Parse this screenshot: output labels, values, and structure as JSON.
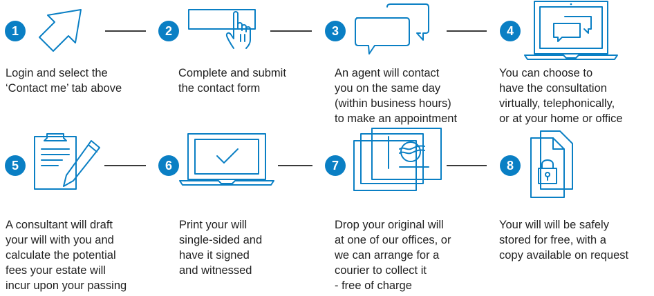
{
  "steps": [
    {
      "number": "1",
      "icon": "arrow-cursor-icon",
      "text": "Login and select the\n‘Contact me’ tab above"
    },
    {
      "number": "2",
      "icon": "hand-click-button-icon",
      "text": "Complete and submit\nthe contact form"
    },
    {
      "number": "3",
      "icon": "chat-bubbles-icon",
      "text": "An agent will contact\nyou on the same day\n(within business hours)\nto make an appointment"
    },
    {
      "number": "4",
      "icon": "laptop-chat-icon",
      "text": "You can choose to\nhave the consultation\nvirtually, telephonically,\nor at your home or office"
    },
    {
      "number": "5",
      "icon": "clipboard-pen-icon",
      "text": "A consultant will draft\nyour will with you and\ncalculate the potential\nfees your estate will\nincur upon your passing"
    },
    {
      "number": "6",
      "icon": "laptop-check-icon",
      "text": "Print your will\nsingle-sided and\nhave it signed\nand witnessed"
    },
    {
      "number": "7",
      "icon": "envelope-cards-icon",
      "text": "Drop your original will\nat one of our offices, or\nwe can arrange for a\ncourier to collect it\n- free of charge"
    },
    {
      "number": "8",
      "icon": "locked-document-icon",
      "text": "Your will will be safely\nstored for free, with a\ncopy available on request"
    }
  ],
  "colors": {
    "accent": "#0a7fc4",
    "text": "#222222",
    "connector": "#3a3a3a"
  }
}
